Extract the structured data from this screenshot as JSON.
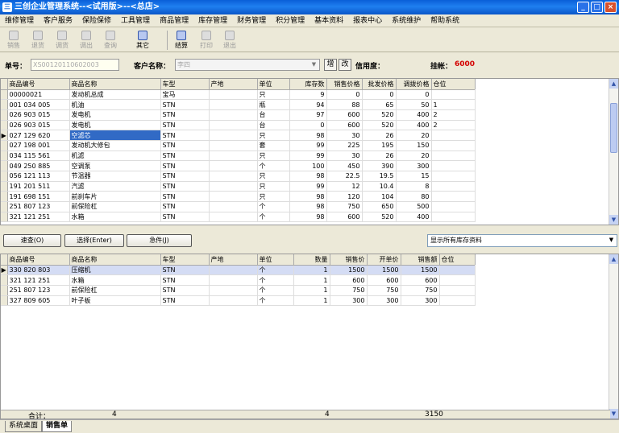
{
  "window": {
    "title": "三创企业管理系统--<试用版>--<总店>"
  },
  "menu": [
    "维修管理",
    "客户服务",
    "保险保修",
    "工具管理",
    "商品管理",
    "库存管理",
    "财务管理",
    "积分管理",
    "基本资料",
    "报表中心",
    "系统维护",
    "帮助系统"
  ],
  "toolbar": {
    "items": [
      "销售",
      "退货",
      "调货",
      "调出",
      "查询",
      "其它",
      "结算",
      "打印",
      "退出"
    ]
  },
  "form": {
    "order_label": "单号：",
    "order_value": "XS00120110602003",
    "customer_label": "客户名称：",
    "customer_value": "李四",
    "add_label": "增",
    "edit_label": "改",
    "credit_label": "信用度：",
    "credit_value": "",
    "debt_label": "挂帐：",
    "debt_value": "6000",
    "debt_color": "#d40000"
  },
  "top_grid": {
    "headers": [
      "商品编号",
      "商品名称",
      "车型",
      "产地",
      "单位",
      "库存数",
      "销售价格",
      "批发价格",
      "调拨价格",
      "仓位"
    ],
    "selected_row": 4,
    "rows": [
      [
        "00000021",
        "发动机总成",
        "宝马",
        "",
        "只",
        "9",
        "0",
        "0",
        "0",
        ""
      ],
      [
        "001 034 005",
        "机油",
        "STN",
        "",
        "瓶",
        "94",
        "88",
        "65",
        "50",
        "1"
      ],
      [
        "026 903 015",
        "发电机",
        "STN",
        "",
        "台",
        "97",
        "600",
        "520",
        "400",
        "2"
      ],
      [
        "026 903 015",
        "发电机",
        "STN",
        "",
        "台",
        "0",
        "600",
        "520",
        "400",
        "2"
      ],
      [
        "027 129 620",
        "空滤芯",
        "STN",
        "",
        "只",
        "98",
        "30",
        "26",
        "20",
        ""
      ],
      [
        "027 198 001",
        "发动机大修包",
        "STN",
        "",
        "套",
        "99",
        "225",
        "195",
        "150",
        ""
      ],
      [
        "034 115 561",
        "机滤",
        "STN",
        "",
        "只",
        "99",
        "30",
        "26",
        "20",
        ""
      ],
      [
        "049 250 885",
        "空调泵",
        "STN",
        "",
        "个",
        "100",
        "450",
        "390",
        "300",
        ""
      ],
      [
        "056 121 113",
        "节温器",
        "STN",
        "",
        "只",
        "98",
        "22.5",
        "19.5",
        "15",
        ""
      ],
      [
        "191 201 511",
        "汽滤",
        "STN",
        "",
        "只",
        "99",
        "12",
        "10.4",
        "8",
        ""
      ],
      [
        "191 698 151",
        "前刹车片",
        "STN",
        "",
        "只",
        "98",
        "120",
        "104",
        "80",
        ""
      ],
      [
        "251 807 123",
        "前保险杠",
        "STN",
        "",
        "个",
        "98",
        "750",
        "650",
        "500",
        ""
      ],
      [
        "321 121 251",
        "水箱",
        "STN",
        "",
        "个",
        "98",
        "600",
        "520",
        "400",
        ""
      ]
    ]
  },
  "actions": {
    "quick": "速查(O)",
    "select": "选择(Enter)",
    "urgent": "急件(J)"
  },
  "show_filter": "显示所有库存资料",
  "bottom_grid": {
    "headers": [
      "商品编号",
      "商品名称",
      "车型",
      "产地",
      "单位",
      "数量",
      "销售价",
      "开单价",
      "销售额",
      "仓位"
    ],
    "rows": [
      [
        "330 820 803",
        "压缩机",
        "STN",
        "",
        "个",
        "1",
        "1500",
        "1500",
        "1500",
        ""
      ],
      [
        "321 121 251",
        "水箱",
        "STN",
        "",
        "个",
        "1",
        "600",
        "600",
        "600",
        ""
      ],
      [
        "251 807 123",
        "前保险杠",
        "STN",
        "",
        "个",
        "1",
        "750",
        "750",
        "750",
        ""
      ],
      [
        "327 809 605",
        "叶子板",
        "STN",
        "",
        "个",
        "1",
        "300",
        "300",
        "300",
        ""
      ]
    ],
    "totals": {
      "label": "合计：",
      "count": "4",
      "qty": "4",
      "amount": "3150"
    }
  },
  "tabs": [
    "系统桌面",
    "销售单"
  ]
}
